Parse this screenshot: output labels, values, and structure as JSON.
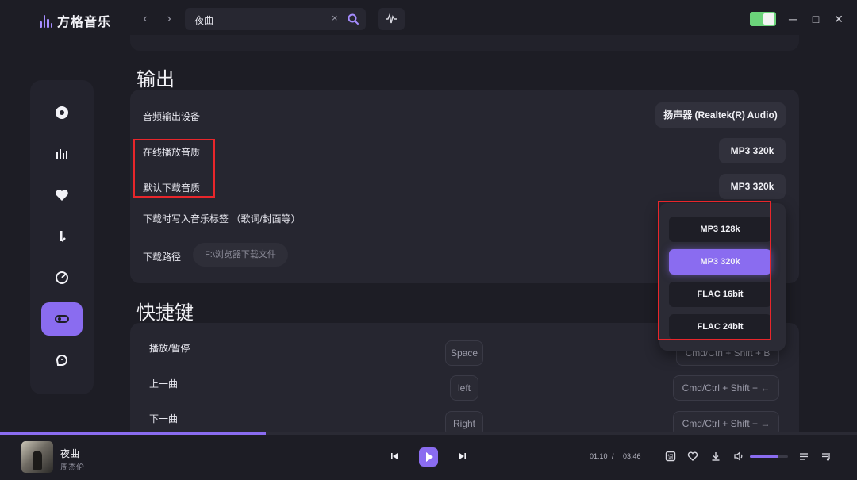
{
  "app": {
    "name": "方格音乐"
  },
  "search": {
    "query": "夜曲",
    "clear_icon": "×"
  },
  "window": {
    "minimize": "─",
    "maximize": "□",
    "close": "✕"
  },
  "sidebar": {
    "items": [
      {
        "name": "disc-icon",
        "active": false
      },
      {
        "name": "chart-icon",
        "active": false
      },
      {
        "name": "heart-icon",
        "active": false
      },
      {
        "name": "music-note-icon",
        "active": false
      },
      {
        "name": "radar-icon",
        "active": false
      },
      {
        "name": "toggle-settings-icon",
        "active": true
      },
      {
        "name": "bubble-icon",
        "active": false
      }
    ]
  },
  "output": {
    "title": "输出",
    "device_label": "音频输出设备",
    "device_value": "扬声器 (Realtek(R) Audio)",
    "online_quality_label": "在线播放音质",
    "online_quality_value": "MP3 320k",
    "download_quality_label": "默认下载音质",
    "download_quality_value": "MP3 320k",
    "write_tags_label": "下载时写入音乐标签 （歌词/封面等）",
    "download_path_label": "下载路径",
    "download_path_value": "F:\\浏览器下载文件"
  },
  "quality_dropdown": {
    "options": [
      "MP3 128k",
      "MP3 320k",
      "FLAC 16bit",
      "FLAC 24bit"
    ],
    "selected": "MP3 320k"
  },
  "shortcuts": {
    "title": "快捷键",
    "rows": [
      {
        "label": "播放/暂停",
        "key": "Space",
        "global": "Cmd/Ctrl + Shift + B"
      },
      {
        "label": "上一曲",
        "key": "left",
        "global": "Cmd/Ctrl + Shift + ←"
      },
      {
        "label": "下一曲",
        "key": "Right",
        "global": "Cmd/Ctrl + Shift + →"
      }
    ]
  },
  "player": {
    "song_title": "夜曲",
    "artist": "周杰伦",
    "current_time": "01:10",
    "time_separator": "/",
    "total_time": "03:46",
    "progress": 0.31,
    "volume": 0.75
  },
  "colors": {
    "accent": "#8a6cf0",
    "highlight": "#e8262b",
    "toggle": "#6bd37a"
  }
}
